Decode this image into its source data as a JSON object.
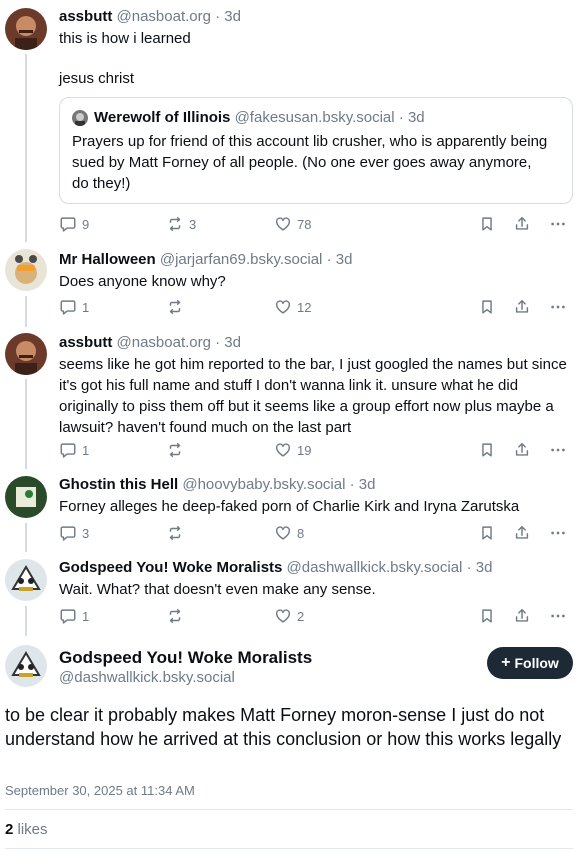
{
  "posts": [
    {
      "name": "assbutt",
      "handle": "@nasboat.org",
      "time": "· 3d",
      "lines": [
        "this is how i learned",
        "jesus christ"
      ],
      "quote": {
        "name": "Werewolf of Illinois",
        "handle": "@fakesusan.bsky.social",
        "time": "· 3d",
        "text": "Prayers up for friend of this account lib crusher, who is apparently being sued by Matt Forney of all people. (No one ever goes away anymore, do they!)"
      },
      "replies": "9",
      "reposts": "3",
      "likes": "78"
    },
    {
      "name": "Mr Halloween",
      "handle": "@jarjarfan69.bsky.social",
      "time": "· 3d",
      "text": "Does anyone know why?",
      "replies": "1",
      "reposts": "",
      "likes": "12"
    },
    {
      "name": "assbutt",
      "handle": "@nasboat.org",
      "time": "· 3d",
      "text": "seems like he got him reported to the bar, I just googled the names but since it's got his full name and stuff I don't wanna link it. unsure what he did originally to piss them off but it seems like a group effort now plus maybe a lawsuit? haven't found much on the last part",
      "replies": "1",
      "reposts": "",
      "likes": "19"
    },
    {
      "name": "Ghostin this Hell",
      "handle": "@hoovybaby.bsky.social",
      "time": "· 3d",
      "text": "Forney alleges he deep-faked porn of Charlie Kirk and Iryna Zarutska",
      "replies": "3",
      "reposts": "",
      "likes": "8"
    },
    {
      "name": "Godspeed You! Woke Moralists",
      "handle": "@dashwallkick.bsky.social",
      "time": "· 3d",
      "text": "Wait. What? that doesn't even make any sense.",
      "replies": "1",
      "reposts": "",
      "likes": "2"
    }
  ],
  "main": {
    "name": "Godspeed You! Woke Moralists",
    "handle": "@dashwallkick.bsky.social",
    "follow_label": "Follow",
    "text": "to be clear it probably makes Matt Forney moron-sense I just do not understand how he arrived at this conclusion or how this works legally",
    "date": "September 30, 2025 at 11:34 AM",
    "likes_count": "2",
    "likes_label": "likes"
  },
  "icons": {
    "reply": "reply-icon",
    "repost": "repost-icon",
    "like": "heart-icon",
    "bookmark": "bookmark-icon",
    "share": "share-icon",
    "more": "more-icon"
  },
  "colors": {
    "text": "#0b0f14",
    "muted": "#6f7b88",
    "border": "#d4dbe2",
    "follow_bg": "#1d2a36"
  }
}
